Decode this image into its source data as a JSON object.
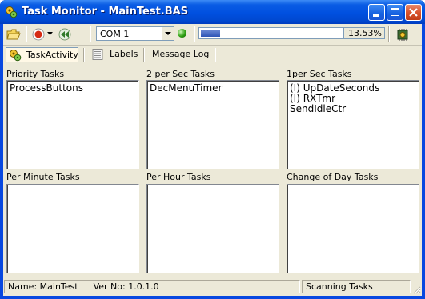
{
  "window": {
    "title": "Task Monitor - MainTest.BAS",
    "colors": {
      "titlebar": "#0050e0",
      "client": "#ece9d8",
      "progress": "#2d55b6",
      "led": "#2fa012"
    }
  },
  "toolbar": {
    "open_icon": "folder-open-icon",
    "stop_icon": "stop-record-icon",
    "rewind_icon": "rewind-icon",
    "com_port": "COM  1",
    "connection_icon": "green-led-icon",
    "progress": 0.1353,
    "progress_label": "13.53%",
    "settings_icon": "gear-chip-icon"
  },
  "tabs": [
    {
      "label": "TaskActivity",
      "icon": "gears-icon",
      "active": true
    },
    {
      "label": "Labels",
      "icon": "document-list-icon",
      "active": false
    },
    {
      "label": "Message Log",
      "icon": "",
      "active": false
    }
  ],
  "panels": [
    {
      "label": "Priority Tasks",
      "items": [
        "ProcessButtons"
      ]
    },
    {
      "label": "2 per Sec Tasks",
      "items": [
        "DecMenuTimer"
      ]
    },
    {
      "label": "1per Sec Tasks",
      "items": [
        "(I) UpDateSeconds",
        "(I) RXTmr",
        "SendIdleCtr"
      ]
    },
    {
      "label": "Per Minute Tasks",
      "items": []
    },
    {
      "label": "Per Hour Tasks",
      "items": []
    },
    {
      "label": "Change of Day Tasks",
      "items": []
    }
  ],
  "status": {
    "name_label": "Name: MainTest",
    "version_label": "Ver No: 1.0.1.0",
    "state": "Scanning Tasks"
  }
}
